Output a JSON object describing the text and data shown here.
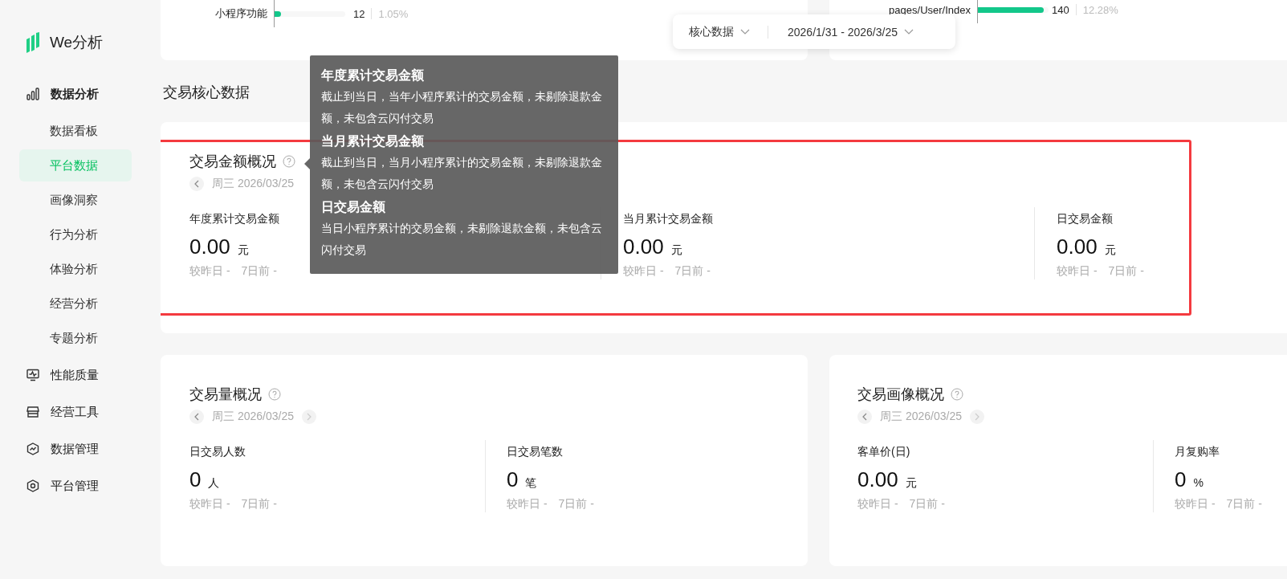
{
  "sidebar": {
    "logo": "We分析",
    "items": [
      {
        "label": "数据分析",
        "expanded": true,
        "children": [
          {
            "label": "数据看板",
            "selected": false
          },
          {
            "label": "平台数据",
            "selected": true
          },
          {
            "label": "画像洞察",
            "selected": false
          },
          {
            "label": "行为分析",
            "selected": false
          },
          {
            "label": "体验分析",
            "selected": false
          },
          {
            "label": "经营分析",
            "selected": false
          },
          {
            "label": "专题分析",
            "selected": false
          }
        ]
      },
      {
        "label": "性能质量",
        "expanded": false
      },
      {
        "label": "经营工具",
        "expanded": false
      },
      {
        "label": "数据管理",
        "expanded": false
      },
      {
        "label": "平台管理",
        "expanded": false
      }
    ]
  },
  "top_cards": [
    {
      "rows": [
        {
          "label": "小程序功能",
          "level": 0.09,
          "value": "12",
          "share": "1.05%"
        }
      ]
    },
    {
      "rows": [
        {
          "label": "pages/User/Index",
          "level": 0.93,
          "value": "140",
          "share": "12.28%"
        }
      ]
    }
  ],
  "filter": {
    "metric": "核心数据",
    "date_range": "2026/1/31 - 2026/3/25"
  },
  "section_title": "交易核心数据",
  "cards": [
    {
      "title": "交易金额概况",
      "date": "周三 2026/03/25",
      "next_visible": false,
      "highlighted": true,
      "metrics": [
        {
          "label": "年度累计交易金额",
          "value": "0.00",
          "unit": "元",
          "vs_yesterday": "较昨日 -",
          "vs_week": "7日前 -"
        },
        {
          "label": "当月累计交易金额",
          "value": "0.00",
          "unit": "元",
          "vs_yesterday": "较昨日 -",
          "vs_week": "7日前 -"
        },
        {
          "label": "日交易金额",
          "value": "0.00",
          "unit": "元",
          "vs_yesterday": "较昨日 -",
          "vs_week": "7日前 -"
        }
      ]
    },
    {
      "title": "交易量概况",
      "date": "周三 2026/03/25",
      "next_visible": true,
      "highlighted": false,
      "metrics": [
        {
          "label": "日交易人数",
          "value": "0",
          "unit": "人",
          "vs_yesterday": "较昨日 -",
          "vs_week": "7日前 -"
        },
        {
          "label": "日交易笔数",
          "value": "0",
          "unit": "笔",
          "vs_yesterday": "较昨日 -",
          "vs_week": "7日前 -"
        }
      ]
    },
    {
      "title": "交易画像概况",
      "date": "周三 2026/03/25",
      "next_visible": true,
      "highlighted": false,
      "metrics": [
        {
          "label": "客单价(日)",
          "value": "0.00",
          "unit": "元",
          "vs_yesterday": "较昨日 -",
          "vs_week": "7日前 -"
        },
        {
          "label": "月复购率",
          "value": "0",
          "unit": "%",
          "vs_yesterday": "较昨日 -",
          "vs_week": "7日前 -"
        }
      ]
    }
  ],
  "tooltip": {
    "sections": [
      {
        "title": "年度累计交易金额",
        "text": "截止到当日，当年小程序累计的交易金额，未剔除退款金额，未包含云闪付交易"
      },
      {
        "title": "当月累计交易金额",
        "text": "截止到当日，当月小程序累计的交易金额，未剔除退款金额，未包含云闪付交易"
      },
      {
        "title": "日交易金额",
        "text": "当日小程序累计的交易金额，未剔除退款金额，未包含云闪付交易"
      }
    ]
  }
}
